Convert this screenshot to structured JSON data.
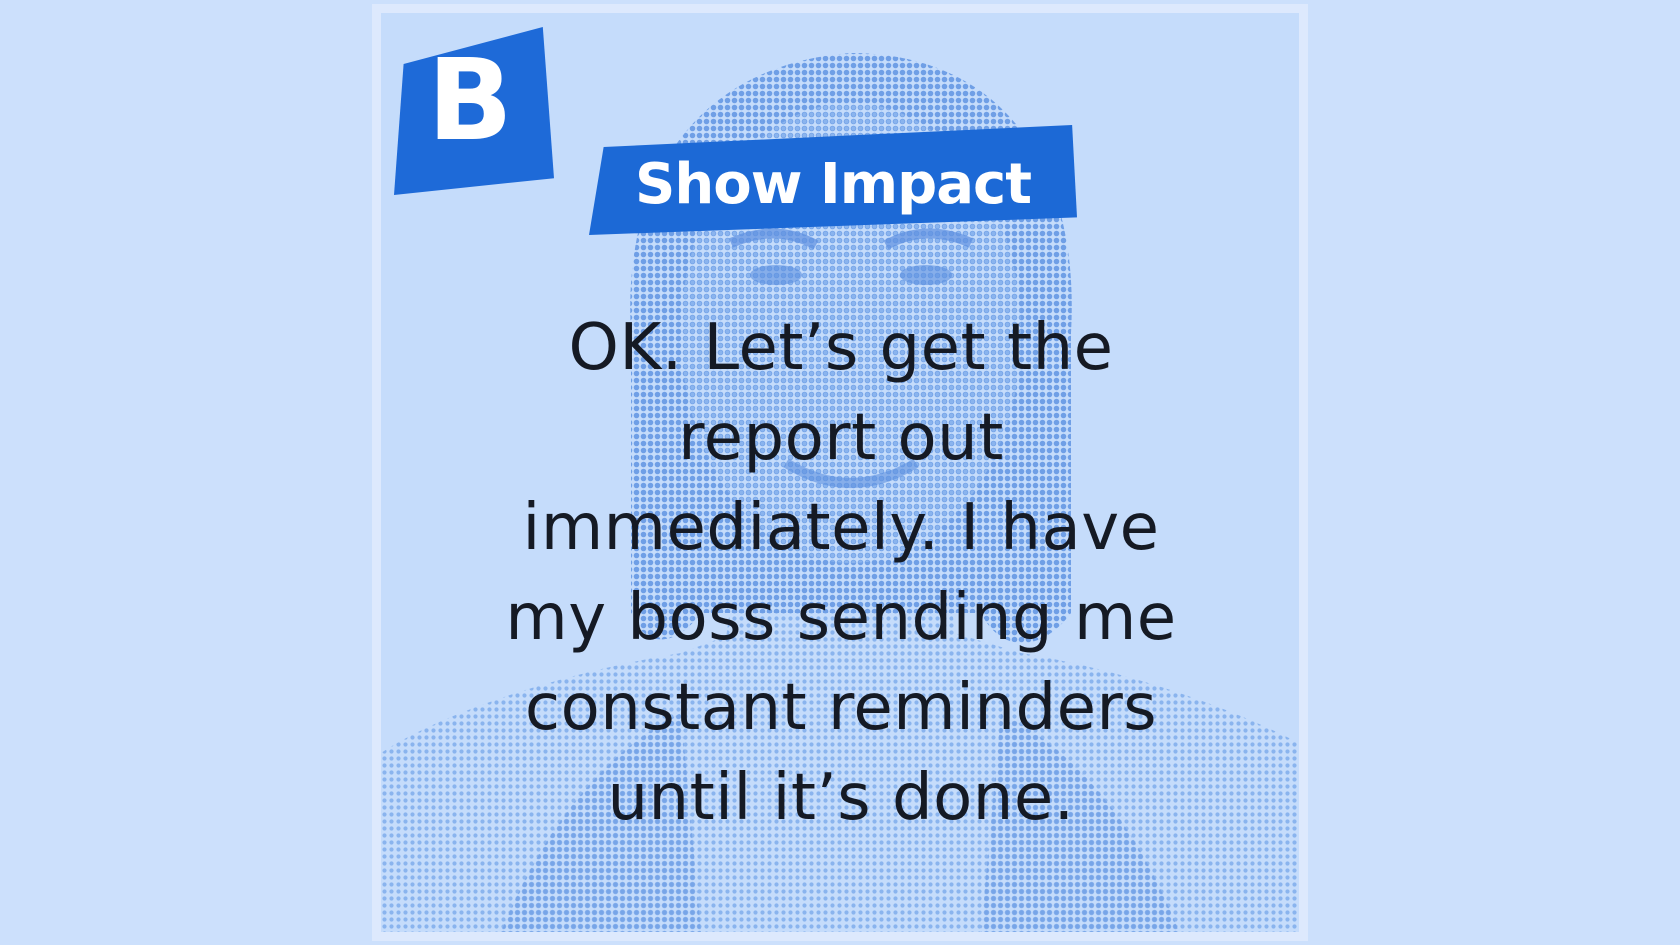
{
  "logo": {
    "letter": "B"
  },
  "tag": {
    "label": "Show Impact"
  },
  "quote": {
    "lines": [
      "OK. Let’s get the",
      "report out",
      "immediately. I have",
      "my boss sending me",
      "constant reminders",
      "until it’s done."
    ]
  },
  "colors": {
    "background": "#cce0fc",
    "card_border": "#dde9fd",
    "accent": "#1e6ad8",
    "text": "#151a24"
  }
}
